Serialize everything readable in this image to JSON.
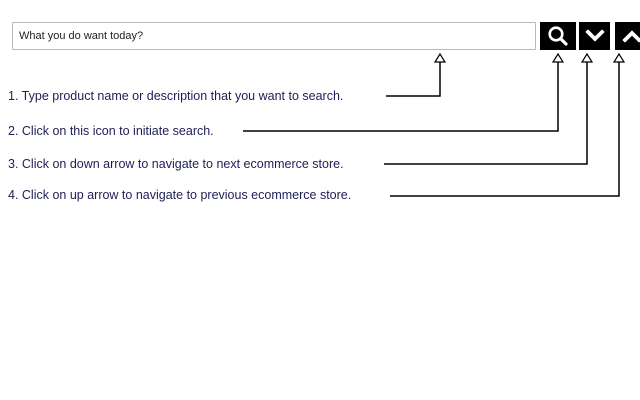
{
  "search": {
    "placeholder": "What you do want today?",
    "value": ""
  },
  "buttons": {
    "search_icon": "search-icon",
    "down_icon": "chevron-down-icon",
    "up_icon": "chevron-up-icon",
    "background": "#000000",
    "icon_color": "#ffffff"
  },
  "instructions": [
    {
      "text": "1. Type product name or  description that you want to search."
    },
    {
      "text": "2. Click on this icon to initiate search."
    },
    {
      "text": "3. Click on down arrow to navigate to next ecommerce store."
    },
    {
      "text": "4. Click on up arrow to navigate to previous ecommerce store."
    }
  ],
  "colors": {
    "text": "#1e1e56",
    "callout_line": "#000000"
  }
}
